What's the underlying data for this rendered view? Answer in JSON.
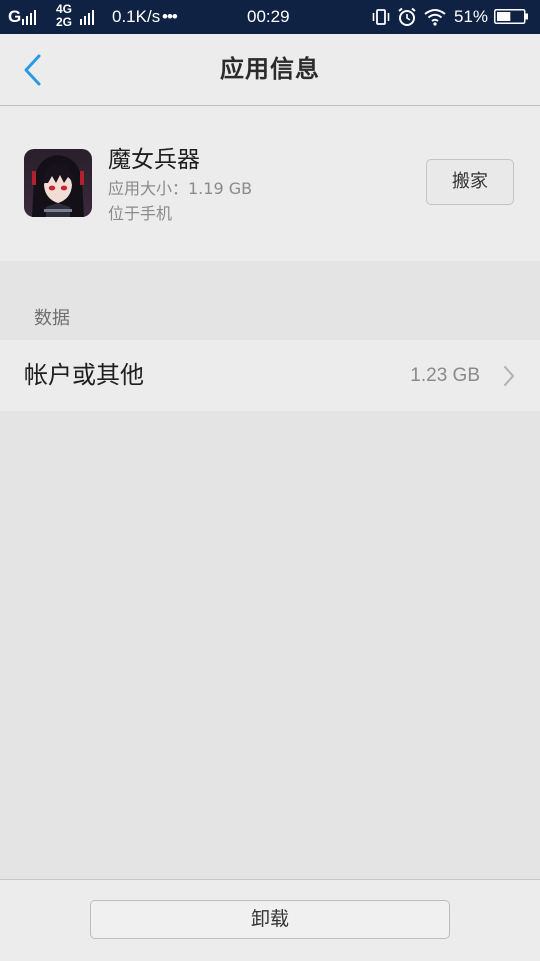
{
  "status_bar": {
    "carrier_signal": "G",
    "network_4g": "4G",
    "network_2g": "2G",
    "net_speed": "0.1K/s",
    "more_dots": "•••",
    "time": "00:29",
    "battery_percent": "51%",
    "battery_level": 0.51,
    "icons": [
      "vibrate-icon",
      "alarm-icon",
      "wifi-icon",
      "battery-icon"
    ]
  },
  "header": {
    "title": "应用信息",
    "back_icon": "chevron-left-icon"
  },
  "app": {
    "name": "魔女兵器",
    "size": "应用大小：1.19 GB",
    "location": "位于手机",
    "move_button": "搬家"
  },
  "data_section": {
    "title": "数据",
    "row_label": "帐户或其他",
    "row_value": "1.23 GB"
  },
  "footer": {
    "uninstall_button": "卸载"
  },
  "colors": {
    "status_bar_bg": "#0f2244",
    "accent_blue": "#2a9be0",
    "page_bg": "#e4e4e4",
    "card_bg": "#ececec"
  }
}
